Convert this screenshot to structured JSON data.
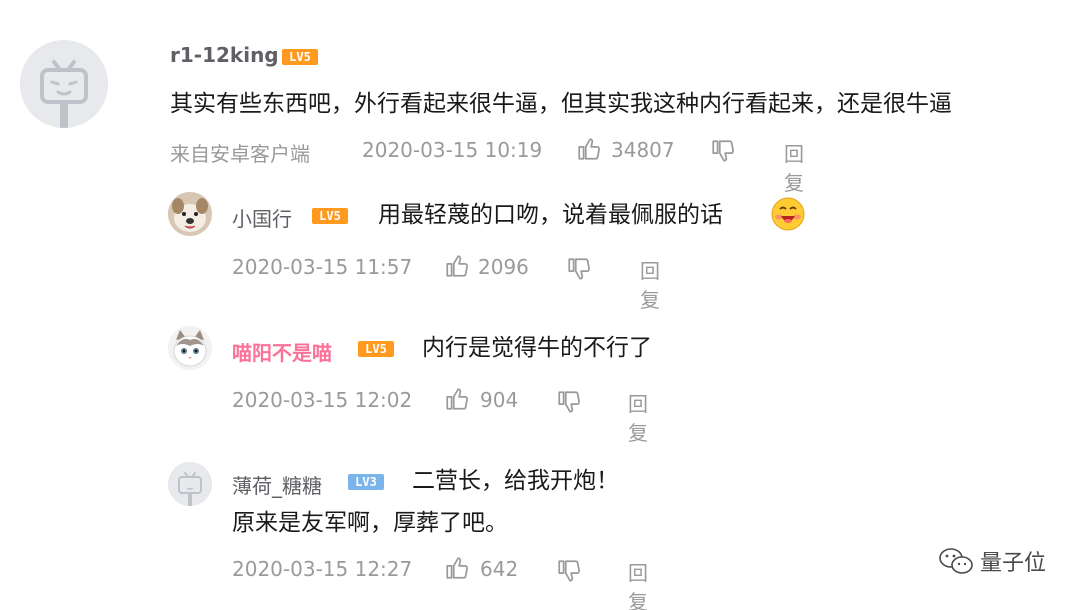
{
  "main_comment": {
    "username": "r1-12king",
    "level": "LV5",
    "text": "其实有些东西吧，外行看起来很牛逼，但其实我这种内行看起来，还是很牛逼",
    "source": "来自安卓客户端",
    "time": "2020-03-15 10:19",
    "likes": "34807",
    "reply_label": "回复"
  },
  "replies": [
    {
      "username": "小国行",
      "level": "LV5",
      "text": "用最轻蔑的口吻，说着最佩服的话",
      "time": "2020-03-15 11:57",
      "likes": "2096",
      "reply_label": "回复",
      "emoji": "grinning-face-emoji"
    },
    {
      "username": "喵阳不是喵",
      "level": "LV5",
      "text": "内行是觉得牛的不行了",
      "time": "2020-03-15 12:02",
      "likes": "904",
      "reply_label": "回复",
      "name_color": "#fb7299"
    },
    {
      "username": "薄荷_糖糖",
      "level": "LV3",
      "text_line1": "二营长，给我开炮！",
      "text_line2": "原来是友军啊，厚葬了吧。",
      "time": "2020-03-15 12:27",
      "likes": "642",
      "reply_label": "回复"
    }
  ],
  "watermark": {
    "text": "量子位",
    "icon": "wechat-icon"
  },
  "colors": {
    "level5": "#ff9a1f",
    "level3": "#79b4ea",
    "vip_name": "#fb7299",
    "meta": "#9a9a9a"
  }
}
